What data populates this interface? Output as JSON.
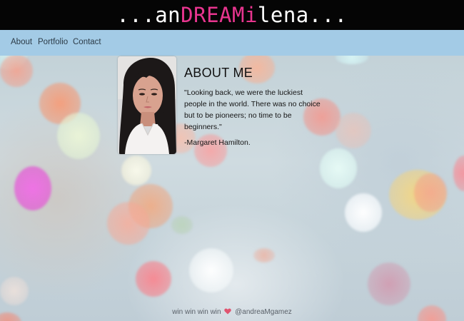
{
  "header": {
    "title_prefix": "...an",
    "title_highlight": "DREAMi",
    "title_suffix": "lena...",
    "highlight_color": "#e8358f",
    "background_color": "#050505"
  },
  "nav": {
    "background_color": "#a3cbe6",
    "items": [
      {
        "label": "About"
      },
      {
        "label": "Portfolio"
      },
      {
        "label": "Contact"
      }
    ]
  },
  "about": {
    "heading": "ABOUT ME",
    "quote": "\"Looking back, we were the luckiest people in the world. There was no choice but to be pioneers; no time to be beginners.\"",
    "author": "-Margaret Hamilton.",
    "photo_icon": "profile-photo"
  },
  "footer": {
    "text_before": "win win win win",
    "heart_icon": "heart-icon",
    "heart_color": "#e05570",
    "handle": "@andreaMgamez"
  }
}
